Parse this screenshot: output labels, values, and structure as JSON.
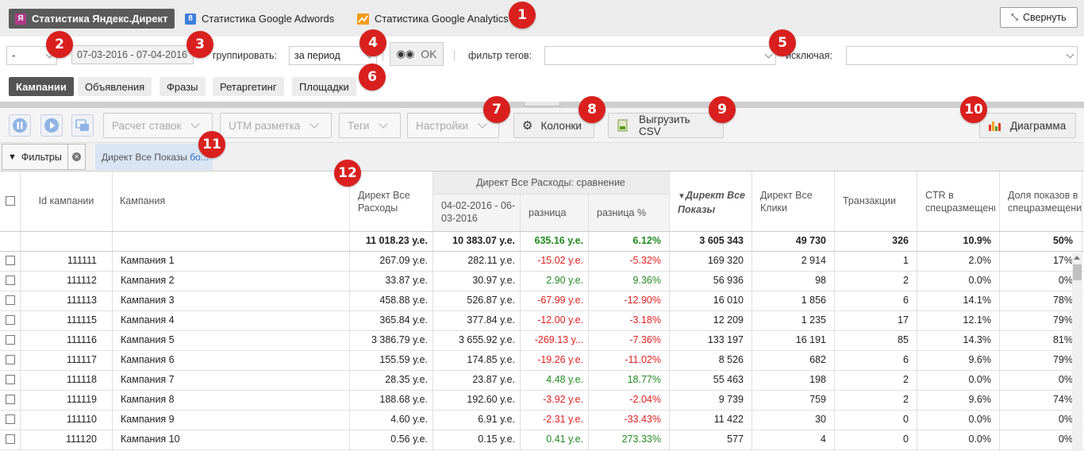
{
  "source_tabs": [
    {
      "label": "Статистика Яндекс.Директ",
      "icon": "yandex-icon",
      "active": true
    },
    {
      "label": "Статистика Google Adwords",
      "icon": "google-icon",
      "active": false
    },
    {
      "label": "Статистика Google Analytics",
      "icon": "analytics-icon",
      "active": false
    }
  ],
  "collapse_label": "Свернуть",
  "filterbar": {
    "account_select": "-",
    "date_range": "07-03-2016 - 07-04-2016",
    "group_label": "группировать:",
    "group_value": "за период",
    "ok_label": "OK",
    "tag_filter_label": "фильтр тегов:",
    "tag_filter_value": "",
    "exclude_label": "исключая:",
    "exclude_value": ""
  },
  "type_tabs": [
    "Кампании",
    "Объявления",
    "Фразы",
    "Ретаргетинг",
    "Площадки"
  ],
  "toolbar": {
    "bids": "Расчет ставок",
    "utm": "UTM разметка",
    "tags": "Теги",
    "settings": "Настройки",
    "columns": "Колонки",
    "export": "Выгрузить CSV",
    "chart": "Диаграмма"
  },
  "filters_label": "Фильтры",
  "chip_text": "Директ Все Показы",
  "chip_more": "бо...",
  "table": {
    "headers": {
      "id": "Id кампании",
      "campaign": "Кампания",
      "cost": "Директ Все Расходы",
      "compare_group": "Директ Все Расходы: сравнение",
      "compare_period": "04-02-2016 - 06-03-2016",
      "diff": "разница",
      "diff_pct": "разница %",
      "impressions": "Директ Все Показы",
      "clicks": "Директ Все Клики",
      "transactions": "Транзакции",
      "ctr": "CTR в спецразмещении",
      "share": "Доля показов в спецразмещении"
    },
    "totals": {
      "cost": "11 018.23 у.е.",
      "compare": "10 383.07 у.е.",
      "diff": "635.16 у.е.",
      "diff_pct": "6.12%",
      "impressions": "3 605 343",
      "clicks": "49 730",
      "transactions": "326",
      "ctr": "10.9%",
      "share": "50%"
    },
    "rows": [
      {
        "id": "111111",
        "name": "Кампания 1",
        "cost": "267.09 у.е.",
        "compare": "282.11 у.е.",
        "diff": "-15.02 у.е.",
        "diff_pct": "-5.32%",
        "impressions": "169 320",
        "clicks": "2 914",
        "transactions": "1",
        "ctr": "2.0%",
        "share": "17%"
      },
      {
        "id": "111112",
        "name": "Кампания 2",
        "cost": "33.87 у.е.",
        "compare": "30.97 у.е.",
        "diff": "2.90 у.е.",
        "diff_pct": "9.36%",
        "impressions": "56 936",
        "clicks": "98",
        "transactions": "2",
        "ctr": "0.0%",
        "share": "0%"
      },
      {
        "id": "111113",
        "name": "Кампания 3",
        "cost": "458.88 у.е.",
        "compare": "526.87 у.е.",
        "diff": "-67.99 у.е.",
        "diff_pct": "-12.90%",
        "impressions": "16 010",
        "clicks": "1 856",
        "transactions": "6",
        "ctr": "14.1%",
        "share": "78%"
      },
      {
        "id": "111115",
        "name": "Кампания 4",
        "cost": "365.84 у.е.",
        "compare": "377.84 у.е.",
        "diff": "-12.00 у.е.",
        "diff_pct": "-3.18%",
        "impressions": "12 209",
        "clicks": "1 235",
        "transactions": "17",
        "ctr": "12.1%",
        "share": "79%"
      },
      {
        "id": "111116",
        "name": "Кампания 5",
        "cost": "3 386.79 у.е.",
        "compare": "3 655.92 у.е.",
        "diff": "-269.13 у...",
        "diff_pct": "-7.36%",
        "impressions": "133 197",
        "clicks": "16 191",
        "transactions": "85",
        "ctr": "14.3%",
        "share": "81%"
      },
      {
        "id": "111117",
        "name": "Кампания 6",
        "cost": "155.59 у.е.",
        "compare": "174.85 у.е.",
        "diff": "-19.26 у.е.",
        "diff_pct": "-11.02%",
        "impressions": "8 526",
        "clicks": "682",
        "transactions": "6",
        "ctr": "9.6%",
        "share": "79%"
      },
      {
        "id": "111118",
        "name": "Кампания 7",
        "cost": "28.35 у.е.",
        "compare": "23.87 у.е.",
        "diff": "4.48 у.е.",
        "diff_pct": "18.77%",
        "impressions": "55 463",
        "clicks": "198",
        "transactions": "2",
        "ctr": "0.0%",
        "share": "0%"
      },
      {
        "id": "111119",
        "name": "Кампания 8",
        "cost": "188.68 у.е.",
        "compare": "192.60 у.е.",
        "diff": "-3.92 у.е.",
        "diff_pct": "-2.04%",
        "impressions": "9 739",
        "clicks": "759",
        "transactions": "2",
        "ctr": "9.6%",
        "share": "74%"
      },
      {
        "id": "111110",
        "name": "Кампания 9",
        "cost": "4.60 у.е.",
        "compare": "6.91 у.е.",
        "diff": "-2.31 у.е.",
        "diff_pct": "-33.43%",
        "impressions": "11 422",
        "clicks": "30",
        "transactions": "0",
        "ctr": "0.0%",
        "share": "0%"
      },
      {
        "id": "111120",
        "name": "Кампания 10",
        "cost": "0.56 у.е.",
        "compare": "0.15 у.е.",
        "diff": "0.41 у.е.",
        "diff_pct": "273.33%",
        "impressions": "577",
        "clicks": "4",
        "transactions": "0",
        "ctr": "0.0%",
        "share": "0%"
      }
    ]
  },
  "markers": [
    "1",
    "2",
    "3",
    "4",
    "5",
    "6",
    "7",
    "8",
    "9",
    "10",
    "11",
    "12"
  ],
  "colors": {
    "negative": "#e02020",
    "positive": "#228b22",
    "marker": "#d9201e",
    "chip": "#d9e5f3"
  }
}
